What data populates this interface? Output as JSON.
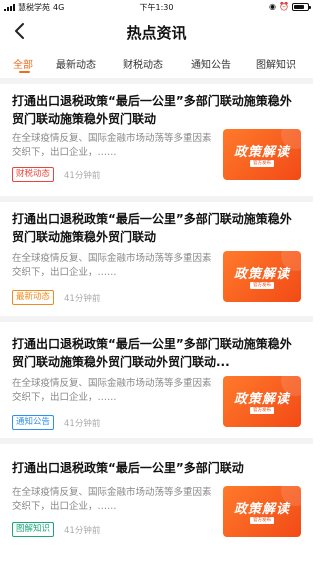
{
  "status_bar": {
    "carrier": "慧税学苑",
    "network": "4G",
    "time": "下午1:30",
    "battery_level": 0.8
  },
  "nav": {
    "title": "热点资讯",
    "back_icon": "chevron-left-icon"
  },
  "tabs": [
    {
      "label": "全部",
      "active": true
    },
    {
      "label": "最新动态",
      "active": false
    },
    {
      "label": "财税动态",
      "active": false
    },
    {
      "label": "通知公告",
      "active": false
    },
    {
      "label": "图解知识",
      "active": false
    }
  ],
  "colors": {
    "accent": "#f26b1d",
    "tag_red": "#e8453c",
    "tag_orange": "#f28a1d",
    "tag_blue": "#2f8ff0",
    "tag_green": "#1aa67a"
  },
  "articles": [
    {
      "title": "打通出口退税政策“最后一公里”多部门联动施策稳外贸门联动施策稳外贸门联动",
      "summary": "在全球疫情反复、国际金融市场动荡等多重因素交织下，出口企业，……",
      "tag": "财税动态",
      "time": "41分钟前",
      "thumb_title": "政策解读",
      "thumb_sub": "官方发布"
    },
    {
      "title": "打通出口退税政策“最后一公里”多部门联动施策稳外贸门联动施策稳外贸门联动",
      "summary": "在全球疫情反复、国际金融市场动荡等多重因素交织下，出口企业，……",
      "tag": "最新动态",
      "time": "41分钟前",
      "thumb_title": "政策解读",
      "thumb_sub": "官方发布"
    },
    {
      "title": "打通出口退税政策“最后一公里”多部门联动施策稳外贸门联动施策稳外贸门联动外贸门联动...",
      "summary": "在全球疫情反复、国际金融市场动荡等多重因素交织下，出口企业，……",
      "tag": "通知公告",
      "time": "41分钟前",
      "thumb_title": "政策解读",
      "thumb_sub": "官方发布"
    },
    {
      "title": "打通出口退税政策“最后一公里”多部门联动",
      "summary": "在全球疫情反复、国际金融市场动荡等多重因素交织下，出口企业，……",
      "tag": "图解知识",
      "time": "41分钟前",
      "thumb_title": "政策解读",
      "thumb_sub": "官方发布"
    }
  ]
}
